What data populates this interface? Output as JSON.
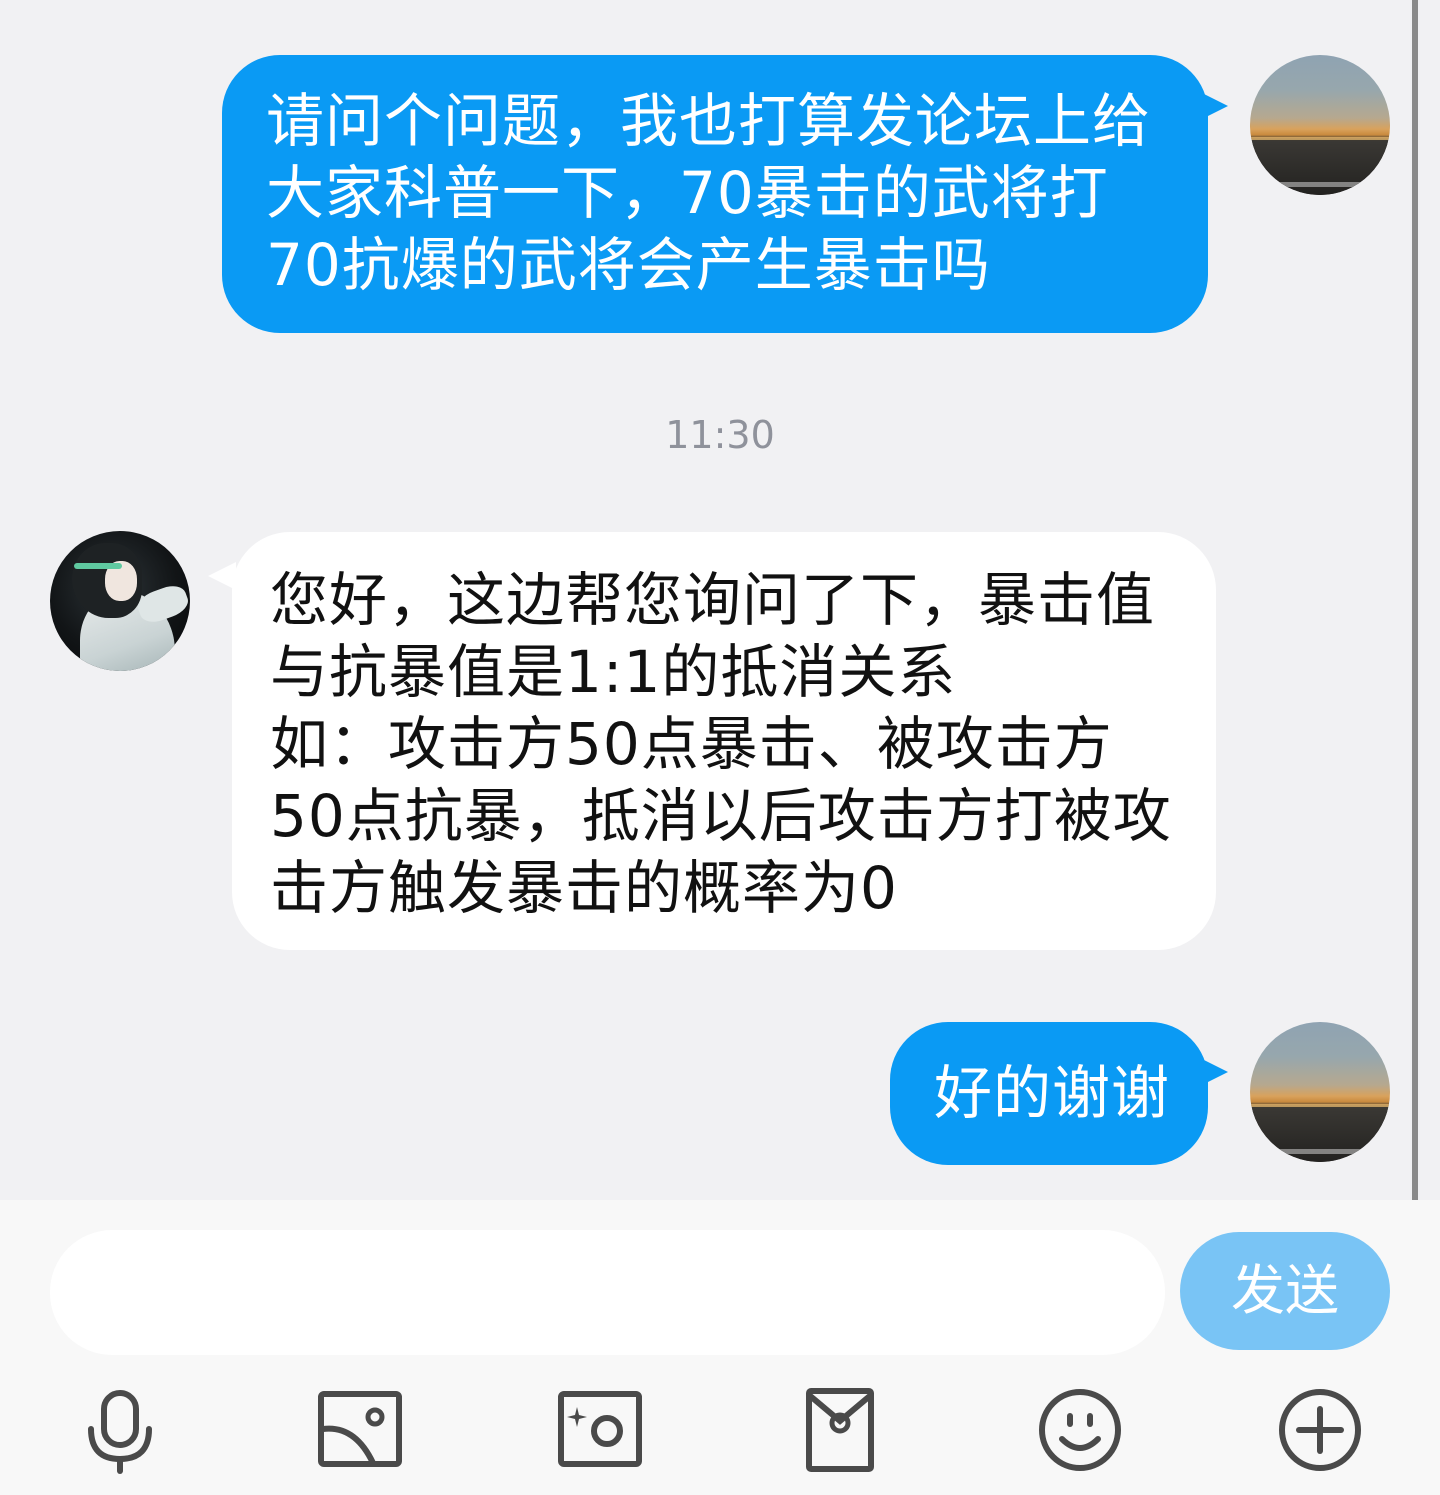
{
  "messages": [
    {
      "direction": "outgoing",
      "lines": [
        "请问个问题，我也打算发论坛上给",
        "大家科普一下，70暴击的武将打",
        "70抗爆的武将会产生暴击吗"
      ]
    },
    {
      "direction": "incoming",
      "lines": [
        "您好，这边帮您询问了下，暴击值",
        "与抗暴值是1:1的抵消关系",
        "如：攻击方50点暴击、被攻击方",
        "50点抗暴，抵消以后攻击方打被攻",
        "击方触发暴击的概率为0"
      ]
    },
    {
      "direction": "outgoing",
      "lines": [
        "好的谢谢"
      ]
    }
  ],
  "timestamp": "11:30",
  "composer": {
    "input_value": "",
    "send_label": "发送"
  },
  "toolbar": [
    {
      "icon": "microphone-icon"
    },
    {
      "icon": "image-icon"
    },
    {
      "icon": "camera-icon"
    },
    {
      "icon": "red-packet-icon"
    },
    {
      "icon": "emoji-icon"
    },
    {
      "icon": "plus-icon"
    }
  ],
  "colors": {
    "outgoing_bubble": "#0a9af4",
    "incoming_bubble": "#ffffff",
    "send_button": "#79c4f5",
    "background": "#f1f1f3"
  }
}
